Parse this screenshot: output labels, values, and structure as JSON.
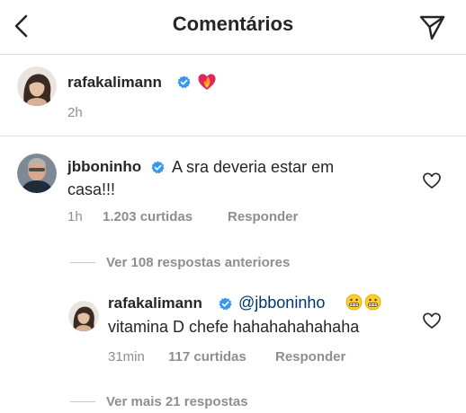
{
  "header": {
    "title": "Comentários",
    "back_icon": "chevron-left-icon",
    "send_icon": "paper-plane-icon"
  },
  "caption": {
    "username": "rafakalimann",
    "verified": true,
    "emoji": "heart-on-fire",
    "time": "2h"
  },
  "comments": [
    {
      "username": "jbboninho",
      "verified": true,
      "text_line1": "A sra deveria estar em",
      "text_line2": "casa!!!",
      "time": "1h",
      "likes": "1.203 curtidas",
      "reply_label": "Responder",
      "view_replies": "Ver 108 respostas anteriores"
    }
  ],
  "reply": {
    "username": "rafakalimann",
    "verified": true,
    "mention": "@jbboninho",
    "emojis": [
      "grimacing-face",
      "grimacing-face"
    ],
    "text": "vitamina D chefe hahahahahahaha",
    "time": "31min",
    "likes": "117 curtidas",
    "reply_label": "Responder",
    "view_more": "Ver mais 21 respostas"
  },
  "colors": {
    "text": "#262626",
    "secondary": "#8e8e8e",
    "verified_blue": "#3897f0",
    "mention": "#00376b",
    "divider": "#dbdbdb"
  }
}
